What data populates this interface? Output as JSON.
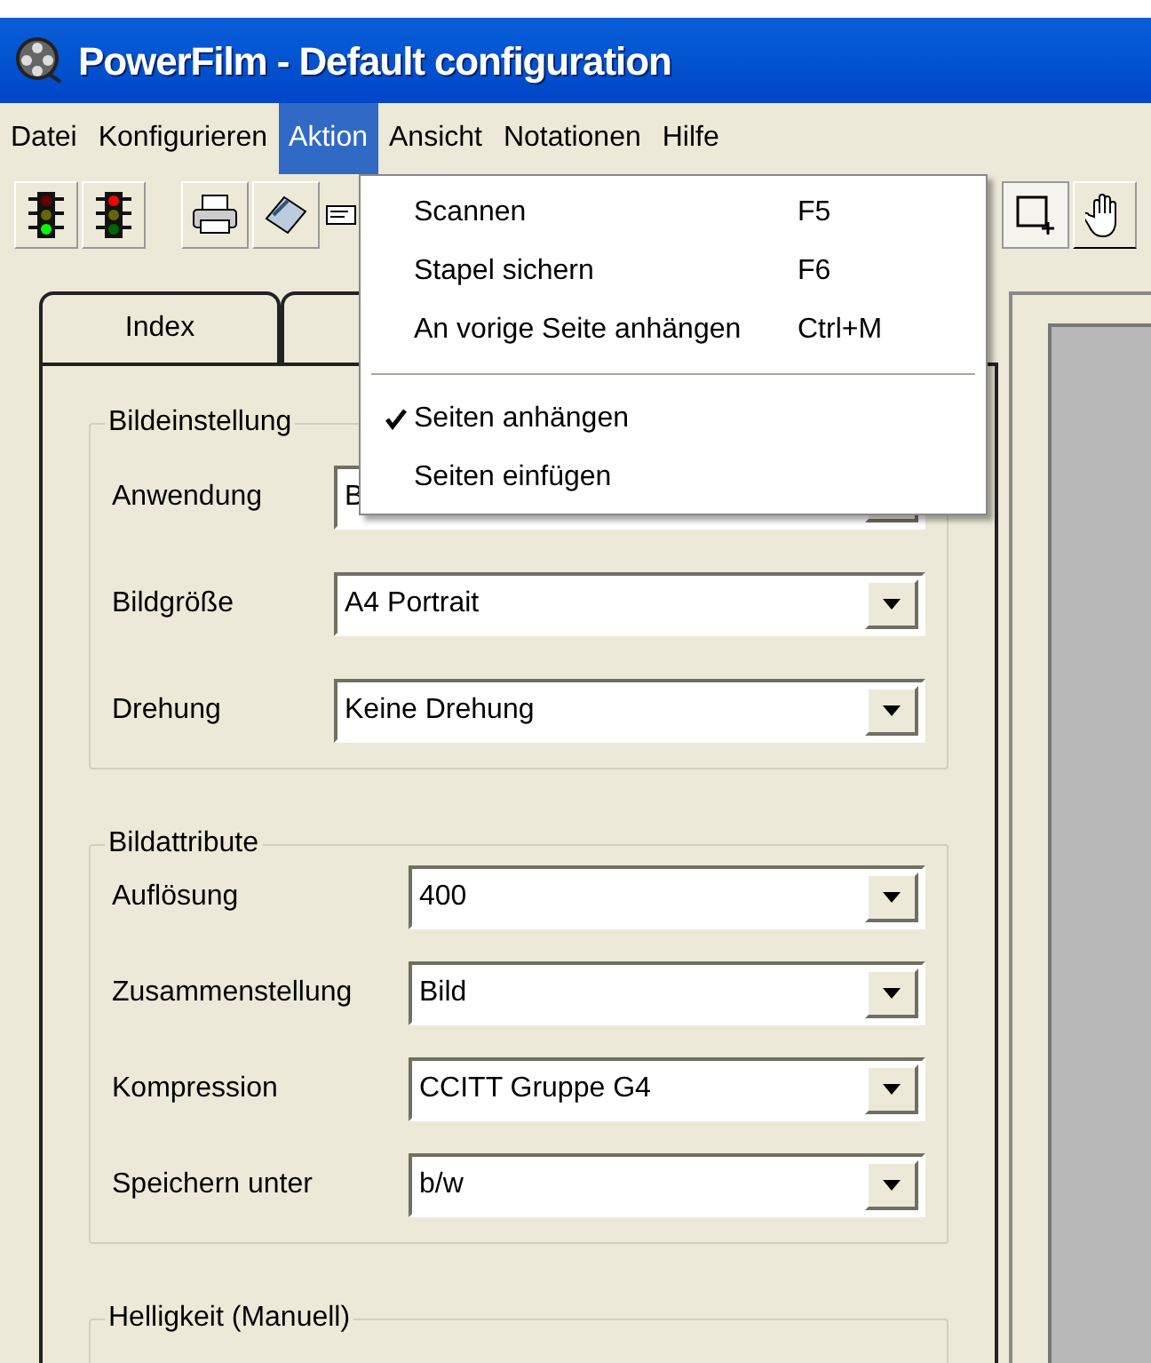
{
  "window": {
    "title": "PowerFilm - Default configuration"
  },
  "menu_bar": [
    {
      "label": "Datei",
      "selected": false
    },
    {
      "label": "Konfigurieren",
      "selected": false
    },
    {
      "label": "Aktion",
      "selected": true
    },
    {
      "label": "Ansicht",
      "selected": false
    },
    {
      "label": "Notationen",
      "selected": false
    },
    {
      "label": "Hilfe",
      "selected": false
    }
  ],
  "open_menu": [
    {
      "kind": "item",
      "label": "Scannen",
      "shortcut": "F5",
      "checked": false
    },
    {
      "kind": "item",
      "label": "Stapel sichern",
      "shortcut": "F6",
      "checked": false
    },
    {
      "kind": "item",
      "label": "An vorige Seite anhängen",
      "shortcut": "Ctrl+M",
      "checked": false
    },
    {
      "kind": "separator"
    },
    {
      "kind": "item",
      "label": "Seiten anhängen",
      "checked": true
    },
    {
      "kind": "item",
      "label": "Seiten einfügen",
      "checked": false
    }
  ],
  "tabs": [
    {
      "label": "Index",
      "selected": true
    }
  ],
  "groups": [
    {
      "title": "Bildeinstellung",
      "fields": [
        {
          "label": "Anwendung",
          "value": "B"
        },
        {
          "label": "Bildgröße",
          "value": "A4 Portrait"
        },
        {
          "label": "Drehung",
          "value": "Keine Drehung"
        }
      ]
    },
    {
      "title": "Bildattribute",
      "fields": [
        {
          "label": "Auflösung",
          "value": "400"
        },
        {
          "label": "Zusammenstellung",
          "value": "Bild"
        },
        {
          "label": "Kompression",
          "value": "CCITT Gruppe G4"
        },
        {
          "label": "Speichern unter",
          "value": "b/w"
        }
      ]
    },
    {
      "title": "Helligkeit (Manuell)"
    }
  ]
}
